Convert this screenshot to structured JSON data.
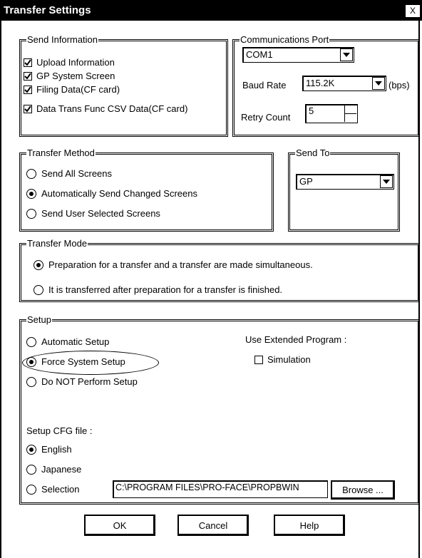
{
  "window": {
    "title": "Transfer Settings",
    "close_label": "X"
  },
  "send_information": {
    "legend": "Send Information",
    "items": [
      {
        "label": "Upload Information",
        "checked": true
      },
      {
        "label": "GP System Screen",
        "checked": true
      },
      {
        "label": "Filing Data(CF card)",
        "checked": true
      },
      {
        "label": "Data Trans Func CSV Data(CF card)",
        "checked": true
      }
    ]
  },
  "communications_port": {
    "legend": "Communications Port",
    "port_value": "COM1",
    "baud_label": "Baud Rate",
    "baud_value": "115.2K",
    "baud_unit": "(bps)",
    "retry_label": "Retry Count",
    "retry_value": "5"
  },
  "transfer_method": {
    "legend": "Transfer Method",
    "options": [
      {
        "label": "Send All Screens",
        "selected": false
      },
      {
        "label": "Automatically Send Changed Screens",
        "selected": true
      },
      {
        "label": "Send User Selected Screens",
        "selected": false
      }
    ]
  },
  "send_to": {
    "legend": "Send To",
    "value": "GP"
  },
  "transfer_mode": {
    "legend": "Transfer Mode",
    "options": [
      {
        "label": "Preparation for a transfer and a transfer are made simultaneous.",
        "selected": true
      },
      {
        "label": "It is transferred after preparation for a transfer is finished.",
        "selected": false
      }
    ]
  },
  "setup": {
    "legend": "Setup",
    "options": [
      {
        "label": "Automatic Setup",
        "selected": false
      },
      {
        "label": "Force System Setup",
        "selected": true
      },
      {
        "label": "Do NOT Perform Setup",
        "selected": false
      }
    ],
    "extended_label": "Use Extended Program :",
    "simulation_label": "Simulation",
    "simulation_checked": false,
    "cfg_label": "Setup CFG file :",
    "cfg_options": [
      {
        "label": "English",
        "selected": true
      },
      {
        "label": "Japanese",
        "selected": false
      },
      {
        "label": "Selection",
        "selected": false
      }
    ],
    "path_value": "C:\\PROGRAM FILES\\PRO-FACE\\PROPBWIN",
    "browse_label": "Browse ..."
  },
  "buttons": {
    "ok": "OK",
    "cancel": "Cancel",
    "help": "Help"
  }
}
